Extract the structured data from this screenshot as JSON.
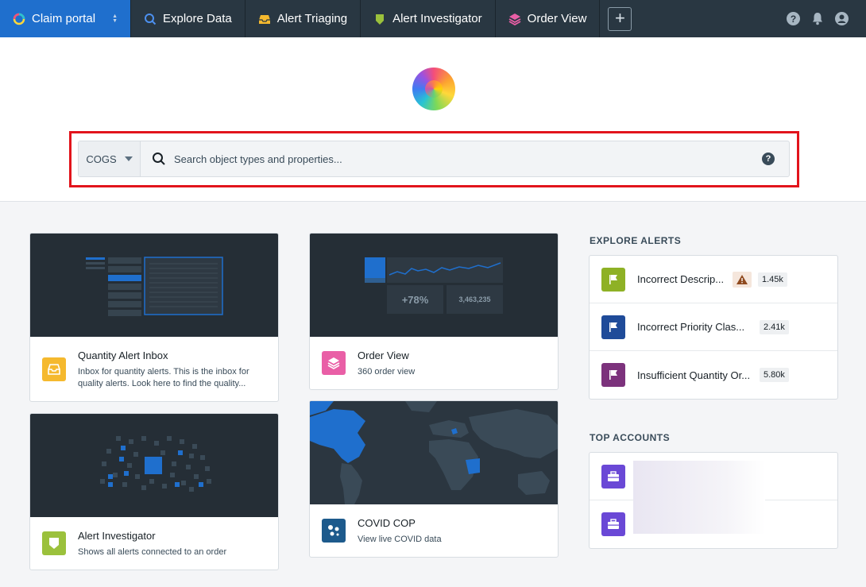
{
  "topbar": {
    "tabs": [
      {
        "label": "Claim portal",
        "icon": "logo-ring-icon",
        "active": true
      },
      {
        "label": "Explore Data",
        "icon": "search-icon"
      },
      {
        "label": "Alert Triaging",
        "icon": "inbox-icon"
      },
      {
        "label": "Alert Investigator",
        "icon": "badge-icon"
      },
      {
        "label": "Order View",
        "icon": "layers-icon"
      }
    ],
    "add_tab": "+",
    "right_icons": [
      "help-icon",
      "bell-icon",
      "user-icon"
    ]
  },
  "search": {
    "scope": "COGS",
    "placeholder": "Search object types and properties..."
  },
  "cards": {
    "quantity_inbox": {
      "title": "Quantity Alert Inbox",
      "desc": "Inbox for quantity alerts. This is the inbox for quality alerts. Look here to find the quality..."
    },
    "order_view": {
      "title": "Order View",
      "desc": "360 order view",
      "stat_change": "+78%",
      "stat_total": "3,463,235"
    },
    "alert_investigator": {
      "title": "Alert Investigator",
      "desc": "Shows all alerts connected to an order"
    },
    "covid": {
      "title": "COVID COP",
      "desc": "View live COVID data"
    }
  },
  "explore_alerts": {
    "title": "EXPLORE ALERTS",
    "items": [
      {
        "label": "Incorrect Descrip...",
        "count": "1.45k",
        "color": "#8eb125",
        "warning": true
      },
      {
        "label": "Incorrect Priority Clas...",
        "count": "2.41k",
        "color": "#1f4b99",
        "warning": false
      },
      {
        "label": "Insufficient Quantity Or...",
        "count": "5.80k",
        "color": "#7c327c",
        "warning": false
      }
    ]
  },
  "top_accounts": {
    "title": "TOP ACCOUNTS",
    "items": [
      {
        "icon": "briefcase-icon",
        "color": "#6a48d6"
      },
      {
        "icon": "briefcase-icon",
        "color": "#6a48d6"
      }
    ]
  },
  "colors": {
    "topbar": "#293742",
    "active_tab": "#1f6fcd",
    "highlight": "#e2141c",
    "inbox_card_icon": "#f5b92e",
    "order_card_icon": "#e95fa6",
    "investigator_card_icon": "#9bc13c",
    "covid_card_icon": "#1d5a8c"
  }
}
